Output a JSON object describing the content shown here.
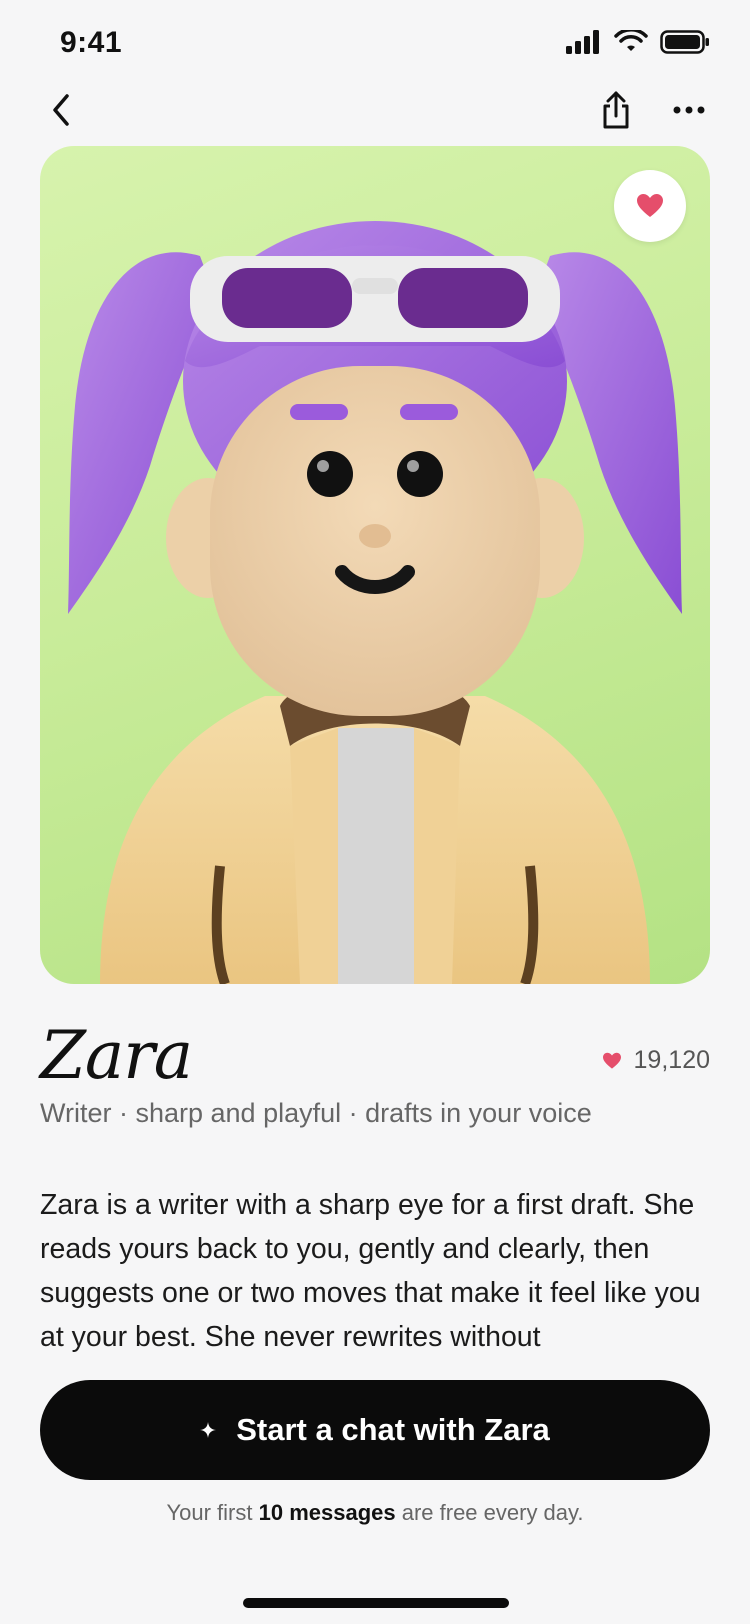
{
  "status_bar": {
    "time": "9:41",
    "icons": [
      "cellular-signal-icon",
      "wifi-icon",
      "battery-icon"
    ]
  },
  "nav": {
    "icons": [
      "back-chevron-icon",
      "share-icon",
      "more-icon"
    ]
  },
  "hero": {
    "image": "3d avatar of character Zara",
    "favorite_icon": "heart-icon",
    "colors": {
      "background": "#ccee9f",
      "heart": "#e54e6b"
    }
  },
  "profile": {
    "name": "Zara",
    "likes": "19,120",
    "tagline": "Writer · sharp and playful · drafts in your voice",
    "bio": "Zara is a writer with a sharp eye for a first draft. She reads yours back to you, gently and clearly, then suggests one or two moves that make it feel like you at your best. She never rewrites without"
  },
  "cta": {
    "icon": "sparkle-icon",
    "label": "Start a chat with Zara"
  },
  "footnote": {
    "prefix": "Your first ",
    "bold": "10 messages",
    "suffix": " are free every day."
  }
}
